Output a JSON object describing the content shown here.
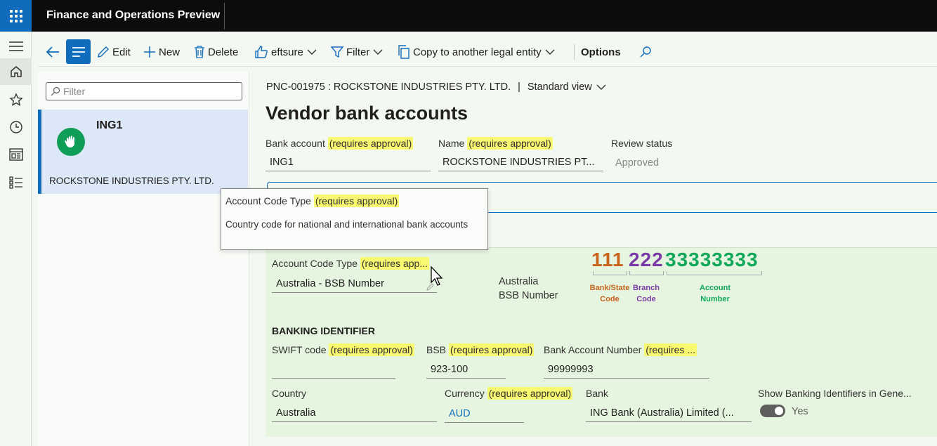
{
  "app": {
    "title": "Finance and Operations Preview"
  },
  "actionbar": {
    "edit": "Edit",
    "new": "New",
    "delete": "Delete",
    "eftsure": "eftsure",
    "filter": "Filter",
    "copy": "Copy to another legal entity",
    "options": "Options"
  },
  "list": {
    "filter_placeholder": "Filter",
    "items": [
      {
        "title": "ING1",
        "subtitle": "ROCKSTONE INDUSTRIES PTY. LTD."
      }
    ]
  },
  "page": {
    "breadcrumb": "PNC-001975 : ROCKSTONE INDUSTRIES PTY. LTD.",
    "view": "Standard view",
    "title": "Vendor bank accounts"
  },
  "approval_tag": "(requires approval)",
  "header_fields": {
    "bank_account": {
      "label": "Bank account",
      "value": "ING1"
    },
    "name": {
      "label": "Name",
      "value": "ROCKSTONE INDUSTRIES PT..."
    },
    "review_status": {
      "label": "Review status",
      "value": "Approved"
    }
  },
  "tooltip": {
    "title": "Account Code Type",
    "body": "Country code for national and international bank accounts"
  },
  "account_code": {
    "label": "Account Code Type",
    "tag_truncated": "(requires app...",
    "value": "Australia - BSB Number",
    "side_label_1": "Australia",
    "side_label_2": "BSB Number"
  },
  "bsb_diagram": {
    "part1": "111",
    "part2": "222",
    "part3": "33333333",
    "cap1_a": "Bank/State",
    "cap1_b": "Code",
    "cap2_a": "Branch",
    "cap2_b": "Code",
    "cap3_a": "Account",
    "cap3_b": "Number",
    "color1": "#c8641c",
    "color2": "#7a3aa8",
    "color3": "#12a85a"
  },
  "banking": {
    "section_title": "BANKING IDENTIFIER",
    "swift": {
      "label": "SWIFT code",
      "value": ""
    },
    "bsb": {
      "label": "BSB",
      "value": "923-100"
    },
    "bank_account_number": {
      "label": "Bank Account Number",
      "tag_truncated": "(requires ...",
      "value": "99999993"
    },
    "country": {
      "label": "Country",
      "value": "Australia"
    },
    "currency": {
      "label": "Currency",
      "value": "AUD"
    },
    "bank": {
      "label": "Bank",
      "value": "ING Bank (Australia) Limited (..."
    },
    "show_ids": {
      "label": "Show Banking Identifiers in Gene...",
      "value": "Yes"
    }
  }
}
